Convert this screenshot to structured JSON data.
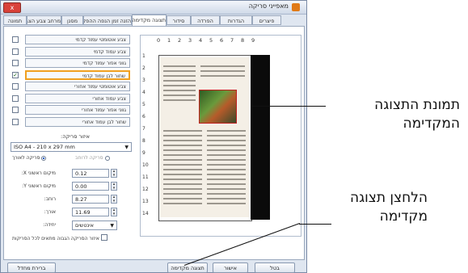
{
  "window": {
    "title": "מאפייני סריקה",
    "close_label": "x"
  },
  "tabs": [
    {
      "label": "תמונה"
    },
    {
      "label": "מרחב צבע הצבע"
    },
    {
      "label": "מסנן"
    },
    {
      "label": "הזנה זמן הנפה ההפלה"
    },
    {
      "label": "תצוגה מקדימה"
    },
    {
      "label": "סידור"
    },
    {
      "label": "הפרדה"
    },
    {
      "label": "הגדרות"
    },
    {
      "label": "פיצרים"
    }
  ],
  "image_list": [
    {
      "label": "צבע אוטומטי עמוד קדמי",
      "checked": false
    },
    {
      "label": "צבע עמוד קדמי",
      "checked": false
    },
    {
      "label": "גווני אפור עמוד קדמי",
      "checked": false
    },
    {
      "label": "שחור לבן עמוד קדמי",
      "checked": true,
      "selected": true
    },
    {
      "label": "צבע אוטומטי עמוד אחורי",
      "checked": false
    },
    {
      "label": "צבע עמוד אחורי",
      "checked": false
    },
    {
      "label": "גווני אפור עמוד אחורי",
      "checked": false
    },
    {
      "label": "שחור לבן עמוד אחורי",
      "checked": false
    }
  ],
  "paper": {
    "label": "איזור סריקה:",
    "size": "ISO A4 - 210 x 297 mm",
    "radio_long": "סריקה לאורך",
    "radio_short": "סריקה לרוחב"
  },
  "fields": [
    {
      "label": "מיקום ראשוני X:",
      "value": "0.12"
    },
    {
      "label": "מיקום ראשוני Y:",
      "value": "0.00"
    },
    {
      "label": "רוחב:",
      "value": "8.27"
    },
    {
      "label": "אורך:",
      "value": "11.69"
    }
  ],
  "units": {
    "label": "יחידה:",
    "value": "אינטשים"
  },
  "auto_checkbox": "איזור הסריקה הגבוה מתאים לכל הסריקות",
  "rulers": {
    "h": [
      "0",
      "1",
      "2",
      "3",
      "4",
      "5",
      "6",
      "7",
      "8",
      "9"
    ],
    "v": [
      "1",
      "2",
      "3",
      "4",
      "5",
      "6",
      "7",
      "8",
      "9",
      "10",
      "11",
      "12",
      "13",
      "14"
    ]
  },
  "buttons": {
    "defaults": "ברירת מחדל",
    "preview": "תצוגה מקדימה",
    "ok": "אישור",
    "cancel": "בטל"
  },
  "callouts": {
    "preview_image_line1": "תמונת התצוגה",
    "preview_image_line2": "המקדימה",
    "preview_button_line1": "הלחצן תצוגה",
    "preview_button_line2": "מקדימה"
  }
}
